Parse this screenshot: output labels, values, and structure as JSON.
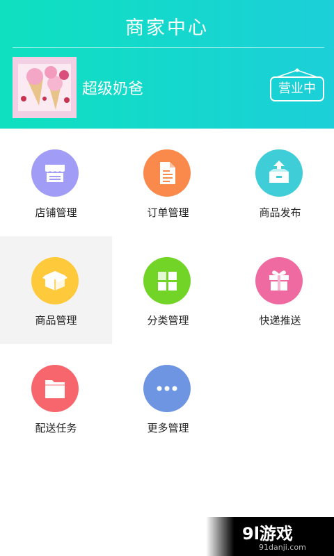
{
  "header": {
    "title": "商家中心",
    "username": "超级奶爸",
    "status": "营业中"
  },
  "menu": [
    {
      "label": "店铺管理",
      "icon": "storefront-icon",
      "color": "#a19cf5"
    },
    {
      "label": "订单管理",
      "icon": "document-icon",
      "color": "#f98a4b"
    },
    {
      "label": "商品发布",
      "icon": "upload-box-icon",
      "color": "#3fcdd8"
    },
    {
      "label": "商品管理",
      "icon": "package-box-icon",
      "color": "#fec93b"
    },
    {
      "label": "分类管理",
      "icon": "grid-icon",
      "color": "#71d427"
    },
    {
      "label": "快递推送",
      "icon": "gift-box-icon",
      "color": "#f06aa2"
    },
    {
      "label": "配送任务",
      "icon": "folder-icon",
      "color": "#f6666c"
    },
    {
      "label": "更多管理",
      "icon": "more-icon",
      "color": "#6d95e2"
    }
  ],
  "watermark": {
    "brand": "9l游戏",
    "domain": "91danji.com"
  }
}
